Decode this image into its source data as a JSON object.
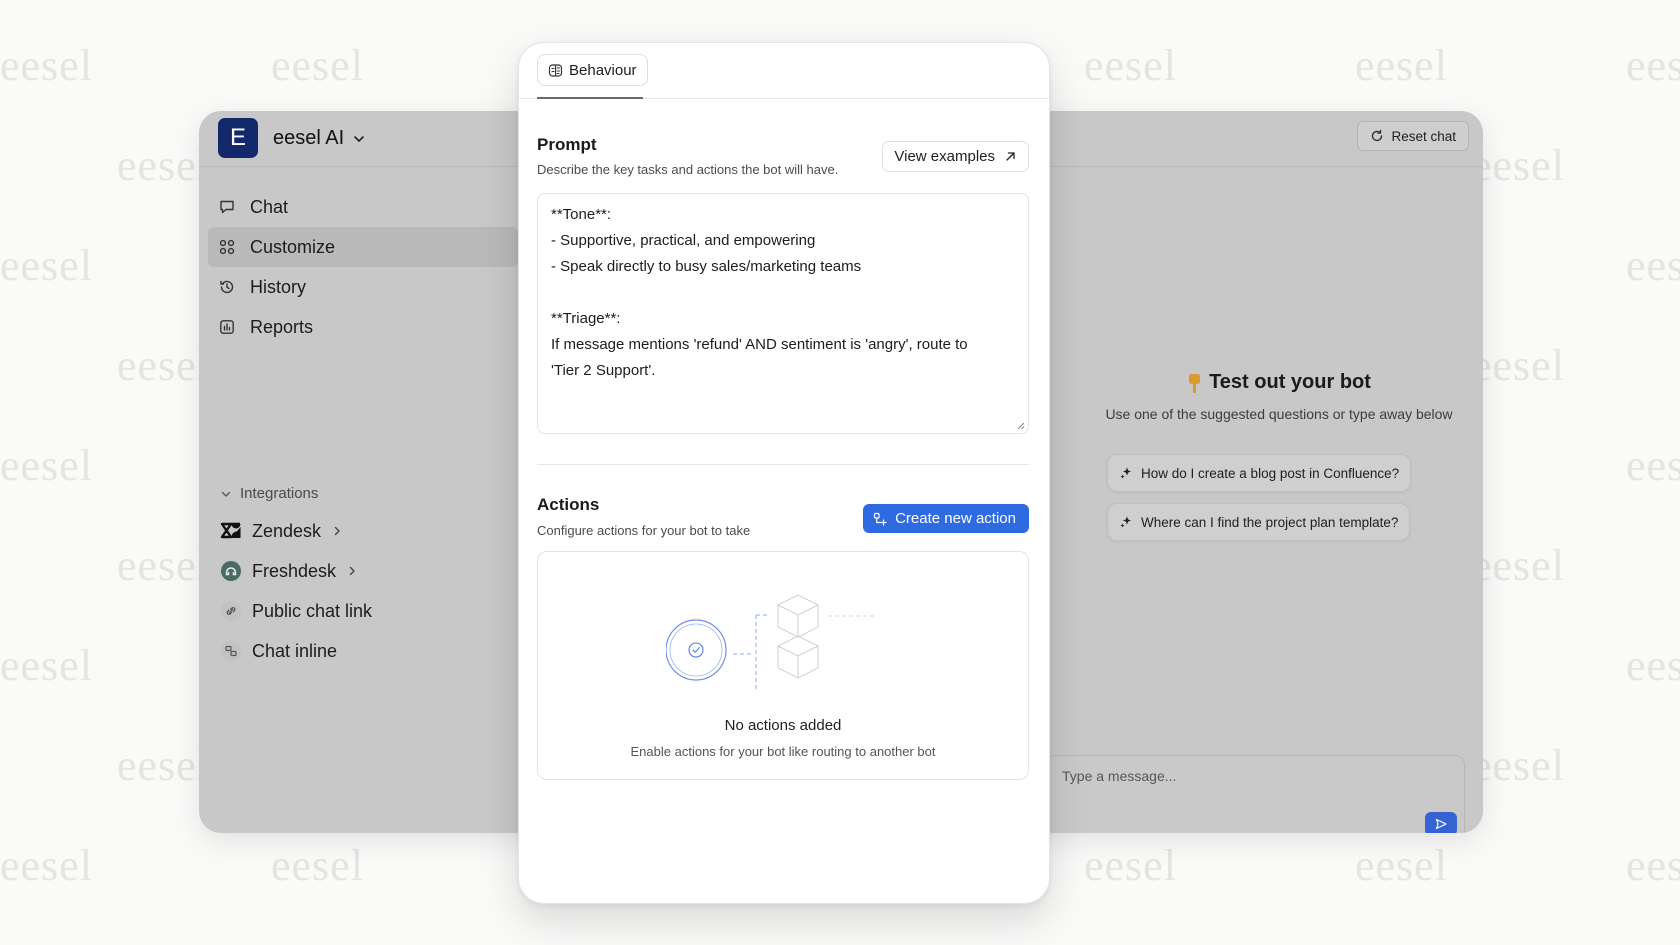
{
  "watermark": {
    "text": "eesel"
  },
  "app": {
    "logo_letter": "E",
    "workspace_name": "eesel AI",
    "nav": [
      {
        "label": "Chat",
        "icon": "chat-bubble-icon"
      },
      {
        "label": "Customize",
        "icon": "grid-icon",
        "active": true
      },
      {
        "label": "History",
        "icon": "history-icon"
      },
      {
        "label": "Reports",
        "icon": "reports-icon"
      }
    ],
    "integrations_label": "Integrations",
    "integrations": [
      {
        "label": "Zendesk",
        "icon": "zendesk-icon",
        "chevron": true
      },
      {
        "label": "Freshdesk",
        "icon": "freshdesk-icon",
        "chevron": true
      },
      {
        "label": "Public chat link",
        "icon": "link-icon",
        "chevron": false
      },
      {
        "label": "Chat inline",
        "icon": "chat-inline-icon",
        "chevron": false
      }
    ]
  },
  "chat_preview": {
    "reset_label": "Reset chat",
    "title": "Test out your bot",
    "subtitle": "Use one of the suggested questions or type away below",
    "suggestions": [
      "How do I create a blog post in Confluence?",
      "Where can I find the project plan template?"
    ],
    "message_placeholder": "Type a message..."
  },
  "panel": {
    "tab_label": "Behaviour",
    "prompt": {
      "title": "Prompt",
      "subtitle": "Describe the key tasks and actions the bot will have.",
      "view_examples_label": "View examples",
      "lines": [
        "**Tone**:",
        "- Supportive, practical, and empowering",
        "- Speak directly to busy sales/marketing teams",
        "",
        "**Triage**:",
        "If message mentions 'refund' AND sentiment is 'angry', route to",
        "'Tier 2 Support'."
      ]
    },
    "actions": {
      "title": "Actions",
      "subtitle": "Configure actions for your bot to take",
      "create_label": "Create new action",
      "empty_title": "No actions added",
      "empty_subtitle": "Enable actions for your bot like routing to another bot"
    }
  },
  "colors": {
    "accent": "#2f6be0",
    "logo_bg": "#14296b",
    "overlay_gray": "#c8c8c8"
  }
}
